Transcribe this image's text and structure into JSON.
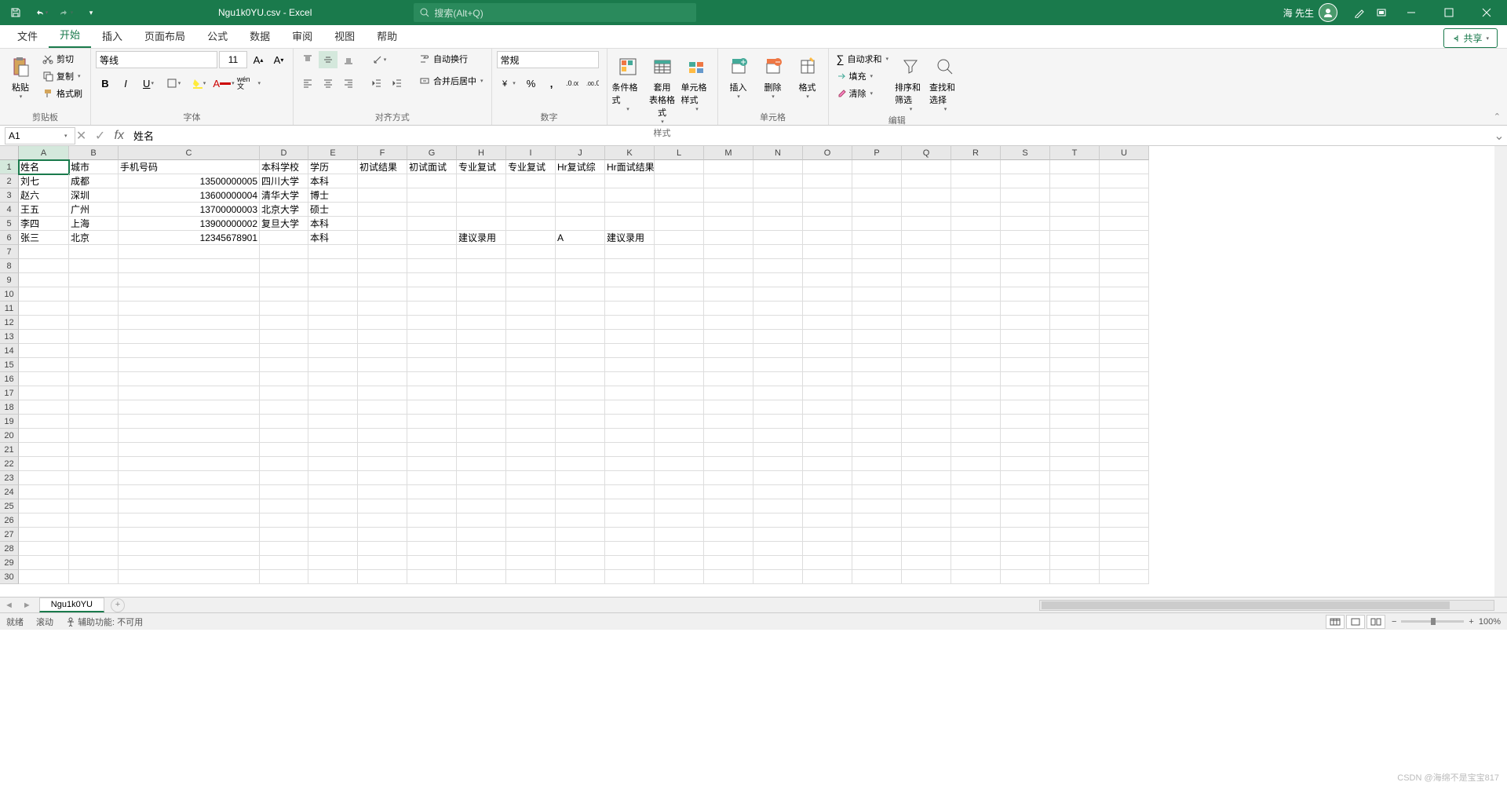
{
  "titlebar": {
    "filename": "Ngu1k0YU.csv - Excel",
    "search_placeholder": "搜索(Alt+Q)",
    "username": "海 先生"
  },
  "tabs": {
    "items": [
      "文件",
      "开始",
      "插入",
      "页面布局",
      "公式",
      "数据",
      "审阅",
      "视图",
      "帮助"
    ],
    "active": 1,
    "share": "共享"
  },
  "ribbon": {
    "clipboard": {
      "label": "剪贴板",
      "paste": "粘贴",
      "cut": "剪切",
      "copy": "复制",
      "painter": "格式刷"
    },
    "font": {
      "label": "字体",
      "name": "等线",
      "size": "11",
      "wen": "wén 文"
    },
    "align": {
      "label": "对齐方式",
      "wrap": "自动换行",
      "merge": "合并后居中"
    },
    "number": {
      "label": "数字",
      "format": "常规"
    },
    "styles": {
      "label": "样式",
      "cond": "条件格式",
      "table": "套用\n表格格式",
      "cell": "单元格样式"
    },
    "cells": {
      "label": "单元格",
      "insert": "插入",
      "delete": "删除",
      "format": "格式"
    },
    "editing": {
      "label": "编辑",
      "sum": "自动求和",
      "fill": "填充",
      "clear": "清除",
      "sort": "排序和筛选",
      "find": "查找和选择"
    }
  },
  "namebox": {
    "ref": "A1",
    "formula": "姓名"
  },
  "grid": {
    "col_widths": {
      "A": 64,
      "B": 63,
      "C": 180,
      "D": 62,
      "E": 63,
      "F": 63,
      "G": 63,
      "H": 63,
      "I": 63,
      "J": 63,
      "K": 63,
      "L": 63,
      "M": 63,
      "N": 63,
      "O": 63,
      "P": 63,
      "Q": 63,
      "R": 63,
      "S": 63,
      "T": 63,
      "U": 63
    },
    "columns": [
      "A",
      "B",
      "C",
      "D",
      "E",
      "F",
      "G",
      "H",
      "I",
      "J",
      "K",
      "L",
      "M",
      "N",
      "O",
      "P",
      "Q",
      "R",
      "S",
      "T",
      "U"
    ],
    "rows": 30,
    "data": [
      {
        "A": "姓名",
        "B": "城市",
        "C": "手机号码",
        "D": "本科学校",
        "E": "学历",
        "F": "初试结果",
        "G": "初试面试",
        "H": "专业复试",
        "I": "专业复试",
        "J": "Hr复试综",
        "K": "Hr面试结果"
      },
      {
        "A": "刘七",
        "B": "成都",
        "C": "13500000005",
        "D": "四川大学",
        "E": "本科"
      },
      {
        "A": "赵六",
        "B": "深圳",
        "C": "13600000004",
        "D": "清华大学",
        "E": "博士"
      },
      {
        "A": "王五",
        "B": "广州",
        "C": "13700000003",
        "D": "北京大学",
        "E": "硕士"
      },
      {
        "A": "李四",
        "B": "上海",
        "C": "13900000002",
        "D": "复旦大学",
        "E": "本科"
      },
      {
        "A": "张三",
        "B": "北京",
        "C": "12345678901",
        "E": "本科",
        "H": "建议录用",
        "J": "A",
        "K": "建议录用"
      }
    ],
    "selected": {
      "row": 1,
      "col": "A"
    }
  },
  "sheet": {
    "name": "Ngu1k0YU"
  },
  "status": {
    "ready": "就绪",
    "scroll": "滚动",
    "access": "辅助功能: 不可用",
    "zoom": "100%"
  },
  "watermark": "CSDN @海绵不是宝宝817"
}
